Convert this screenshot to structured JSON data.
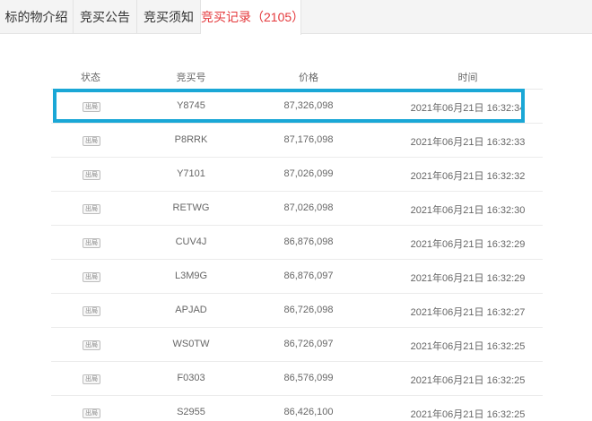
{
  "tabs": [
    {
      "label": "标的物介绍"
    },
    {
      "label": "竞买公告"
    },
    {
      "label": "竞买须知"
    },
    {
      "label": "竞买记录（2105）"
    }
  ],
  "table": {
    "headers": {
      "status": "状态",
      "code": "竞买号",
      "price": "价格",
      "time": "时间"
    },
    "rows": [
      {
        "status": "出局",
        "code": "Y8745",
        "price": "87,326,098",
        "time": "2021年06月21日 16:32:34"
      },
      {
        "status": "出局",
        "code": "P8RRK",
        "price": "87,176,098",
        "time": "2021年06月21日 16:32:33"
      },
      {
        "status": "出局",
        "code": "Y7101",
        "price": "87,026,099",
        "time": "2021年06月21日 16:32:32"
      },
      {
        "status": "出局",
        "code": "RETWG",
        "price": "87,026,098",
        "time": "2021年06月21日 16:32:30"
      },
      {
        "status": "出局",
        "code": "CUV4J",
        "price": "86,876,098",
        "time": "2021年06月21日 16:32:29"
      },
      {
        "status": "出局",
        "code": "L3M9G",
        "price": "86,876,097",
        "time": "2021年06月21日 16:32:29"
      },
      {
        "status": "出局",
        "code": "APJAD",
        "price": "86,726,098",
        "time": "2021年06月21日 16:32:27"
      },
      {
        "status": "出局",
        "code": "WS0TW",
        "price": "86,726,097",
        "time": "2021年06月21日 16:32:25"
      },
      {
        "status": "出局",
        "code": "F0303",
        "price": "86,576,099",
        "time": "2021年06月21日 16:32:25"
      },
      {
        "status": "出局",
        "code": "S2955",
        "price": "86,426,100",
        "time": "2021年06月21日 16:32:25"
      }
    ]
  },
  "colors": {
    "active_tab": "#e4393c",
    "highlight_border": "#1aa7d6"
  }
}
